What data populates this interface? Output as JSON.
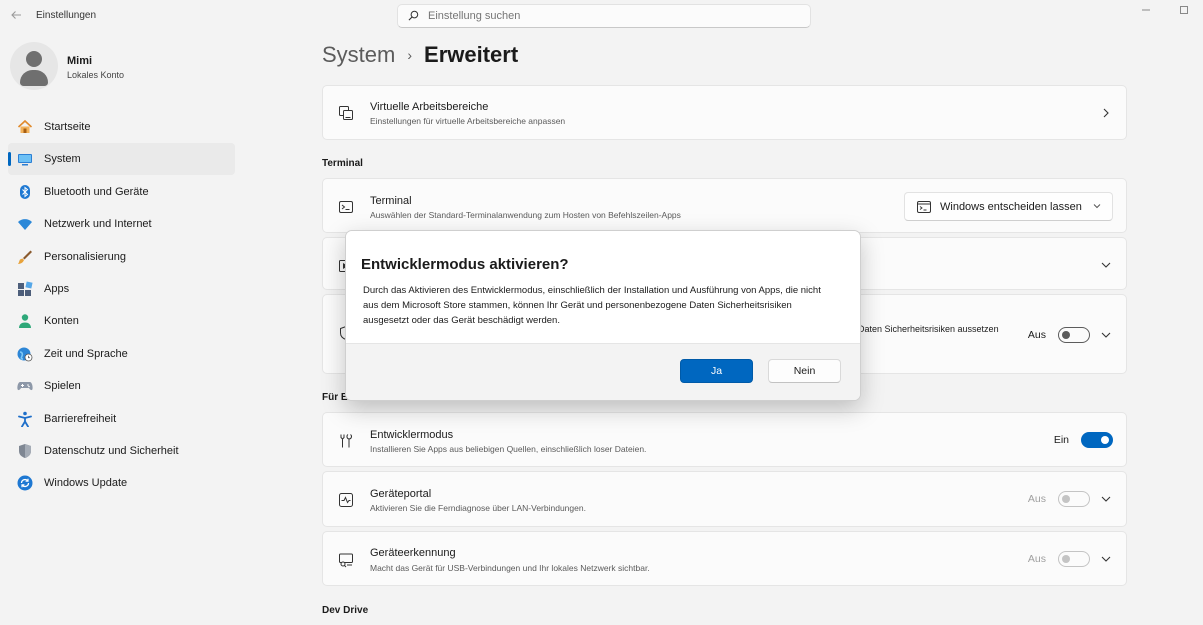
{
  "window": {
    "title": "Einstellungen",
    "controls": [
      "minimize",
      "maximize"
    ]
  },
  "search": {
    "placeholder": "Einstellung suchen"
  },
  "profile": {
    "name": "Mimi",
    "account_type": "Lokales Konto"
  },
  "sidebar": {
    "items": [
      {
        "label": "Startseite",
        "icon": "home-icon",
        "active": false
      },
      {
        "label": "System",
        "icon": "system-display-icon",
        "active": true
      },
      {
        "label": "Bluetooth und Geräte",
        "icon": "bluetooth-icon",
        "active": false
      },
      {
        "label": "Netzwerk und Internet",
        "icon": "wifi-icon",
        "active": false
      },
      {
        "label": "Personalisierung",
        "icon": "brush-icon",
        "active": false
      },
      {
        "label": "Apps",
        "icon": "apps-icon",
        "active": false
      },
      {
        "label": "Konten",
        "icon": "account-icon",
        "active": false
      },
      {
        "label": "Zeit und Sprache",
        "icon": "globe-clock-icon",
        "active": false
      },
      {
        "label": "Spielen",
        "icon": "gamepad-icon",
        "active": false
      },
      {
        "label": "Barrierefreiheit",
        "icon": "accessibility-icon",
        "active": false
      },
      {
        "label": "Datenschutz und Sicherheit",
        "icon": "shield-icon",
        "active": false
      },
      {
        "label": "Windows Update",
        "icon": "windows-update-icon",
        "active": false
      }
    ]
  },
  "breadcrumb": {
    "parent": "System",
    "separator": "›",
    "current": "Erweitert"
  },
  "main": {
    "virtual_workspaces": {
      "title": "Virtuelle Arbeitsbereiche",
      "description": "Einstellungen für virtuelle Arbeitsbereiche anpassen"
    },
    "terminal_section": "Terminal",
    "terminal": {
      "title": "Terminal",
      "description": "Auswählen der Standard-Terminalanwendung zum Hosten von Befehlszeilen-Apps",
      "dropdown_value": "Windows entscheiden lassen"
    },
    "hidden_row_partial": "Daten Sicherheitsrisiken aussetzen",
    "hidden_row_toggle": "Aus",
    "developers_section": "Für Entwickler",
    "developers_section_visible": "Für E",
    "developer_mode": {
      "title": "Entwicklermodus",
      "description": "Installieren Sie Apps aus beliebigen Quellen, einschließlich loser Dateien.",
      "toggle_label": "Ein",
      "on": true
    },
    "device_portal": {
      "title": "Geräteportal",
      "description": "Aktivieren Sie die Ferndiagnose über LAN-Verbindungen.",
      "toggle_label": "Aus",
      "on": false
    },
    "device_discovery": {
      "title": "Geräteerkennung",
      "description": "Macht das Gerät für USB-Verbindungen und Ihr lokales Netzwerk sichtbar.",
      "toggle_label": "Aus",
      "on": false
    },
    "dev_drive_section": "Dev Drive"
  },
  "dialog": {
    "title": "Entwicklermodus aktivieren?",
    "message": "Durch das Aktivieren des Entwicklermodus, einschließlich der Installation und Ausführung von Apps, die nicht aus dem Microsoft Store stammen, können Ihr Gerät und personenbezogene Daten Sicherheitsrisiken ausgesetzt oder das Gerät beschädigt werden.",
    "confirm_label": "Ja",
    "cancel_label": "Nein"
  },
  "colors": {
    "accent": "#0067c0",
    "background": "#f3f3f3",
    "card": "#fbfbfb"
  }
}
